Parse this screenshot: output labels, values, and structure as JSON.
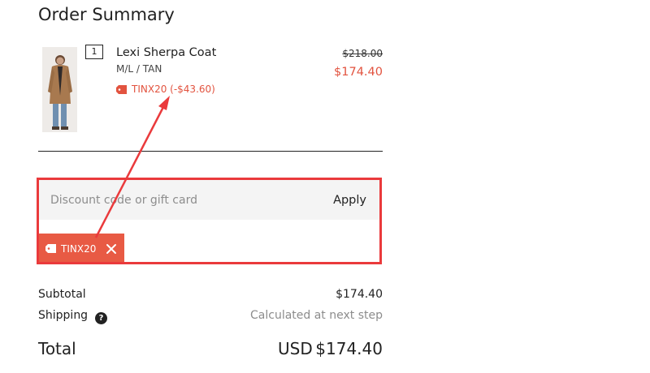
{
  "summary": {
    "title": "Order Summary"
  },
  "item": {
    "quantity": "1",
    "name": "Lexi Sherpa Coat",
    "variant": "M/L / TAN",
    "discount_label": "TINX20 (-$43.60)",
    "original_price": "$218.00",
    "sale_price": "$174.40"
  },
  "discount": {
    "placeholder": "Discount code or gift card",
    "value": "",
    "apply_label": "Apply",
    "applied_code": "TINX20"
  },
  "totals": {
    "subtotal_label": "Subtotal",
    "subtotal_value": "$174.40",
    "shipping_label": "Shipping",
    "shipping_value": "Calculated at next step",
    "total_label": "Total",
    "currency": "USD",
    "total_value": "$174.40"
  },
  "colors": {
    "accent": "#e2533f",
    "chip": "#e85a44",
    "highlight": "#ea3a3c"
  }
}
